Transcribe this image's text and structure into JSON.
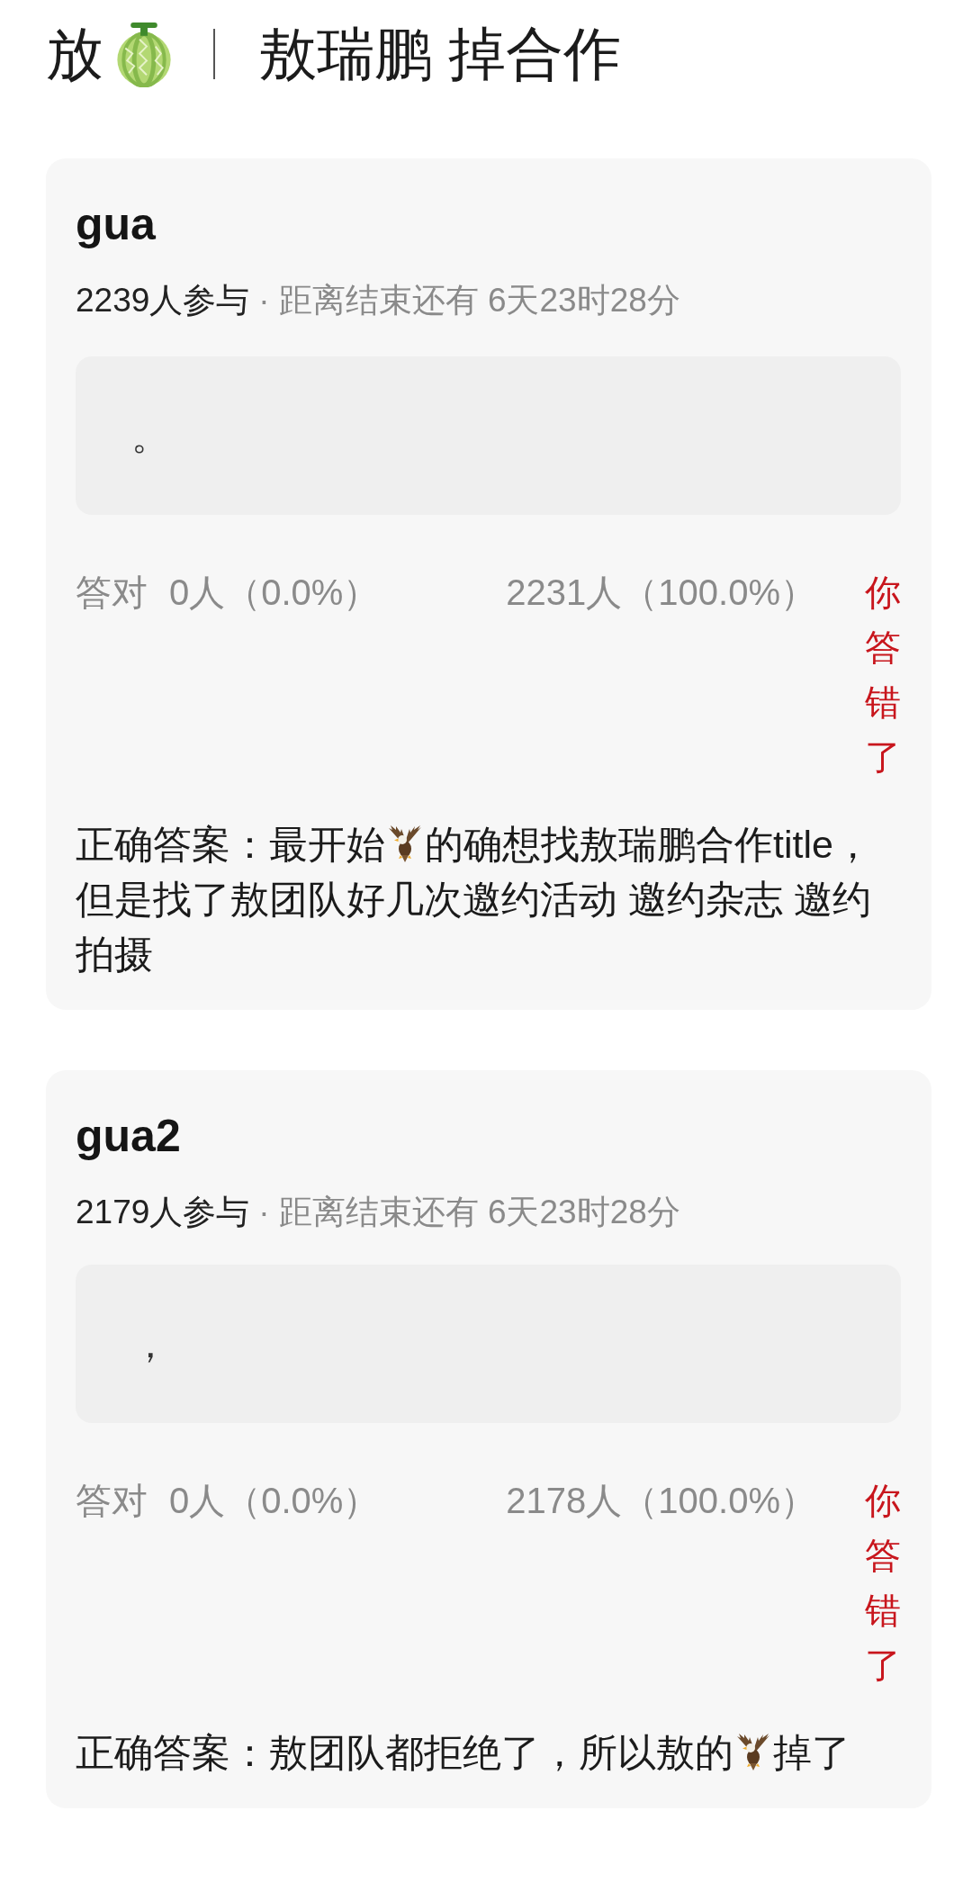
{
  "header": {
    "prefix": "放",
    "title": "敖瑞鹏 掉合作"
  },
  "cards": [
    {
      "title": "gua",
      "meta": {
        "participants": "2239人参与",
        "separator": "·",
        "countdown": "距离结束还有 6天23时28分"
      },
      "option": "。",
      "stats": {
        "correct_label": "答对",
        "correct_count": "0人（0.0%）",
        "wrong_count": "2231人（100.0%）",
        "result": "你答错了",
        "user_correct": false
      },
      "answer": [
        {
          "kind": "text",
          "text": "正确答案：最开始"
        },
        {
          "kind": "icon"
        },
        {
          "kind": "text",
          "text": "的确想找敖瑞鹏合作title，"
        },
        {
          "kind": "text",
          "text": "但是找了敖团队好几次邀约活动 邀约杂志 邀约拍摄"
        }
      ]
    },
    {
      "title": "gua2",
      "meta": {
        "participants": "2179人参与",
        "separator": "·",
        "countdown": "距离结束还有 6天23时28分"
      },
      "option": "，",
      "stats": {
        "correct_label": "答对",
        "correct_count": "0人（0.0%）",
        "wrong_count": "2178人（100.0%）",
        "result": "你答错了",
        "user_correct": false
      },
      "answer": [
        {
          "kind": "text",
          "text": "正确答案：敖团队都拒绝了，所以敖的"
        },
        {
          "kind": "icon"
        },
        {
          "kind": "text",
          "text": "掉了"
        }
      ]
    }
  ]
}
